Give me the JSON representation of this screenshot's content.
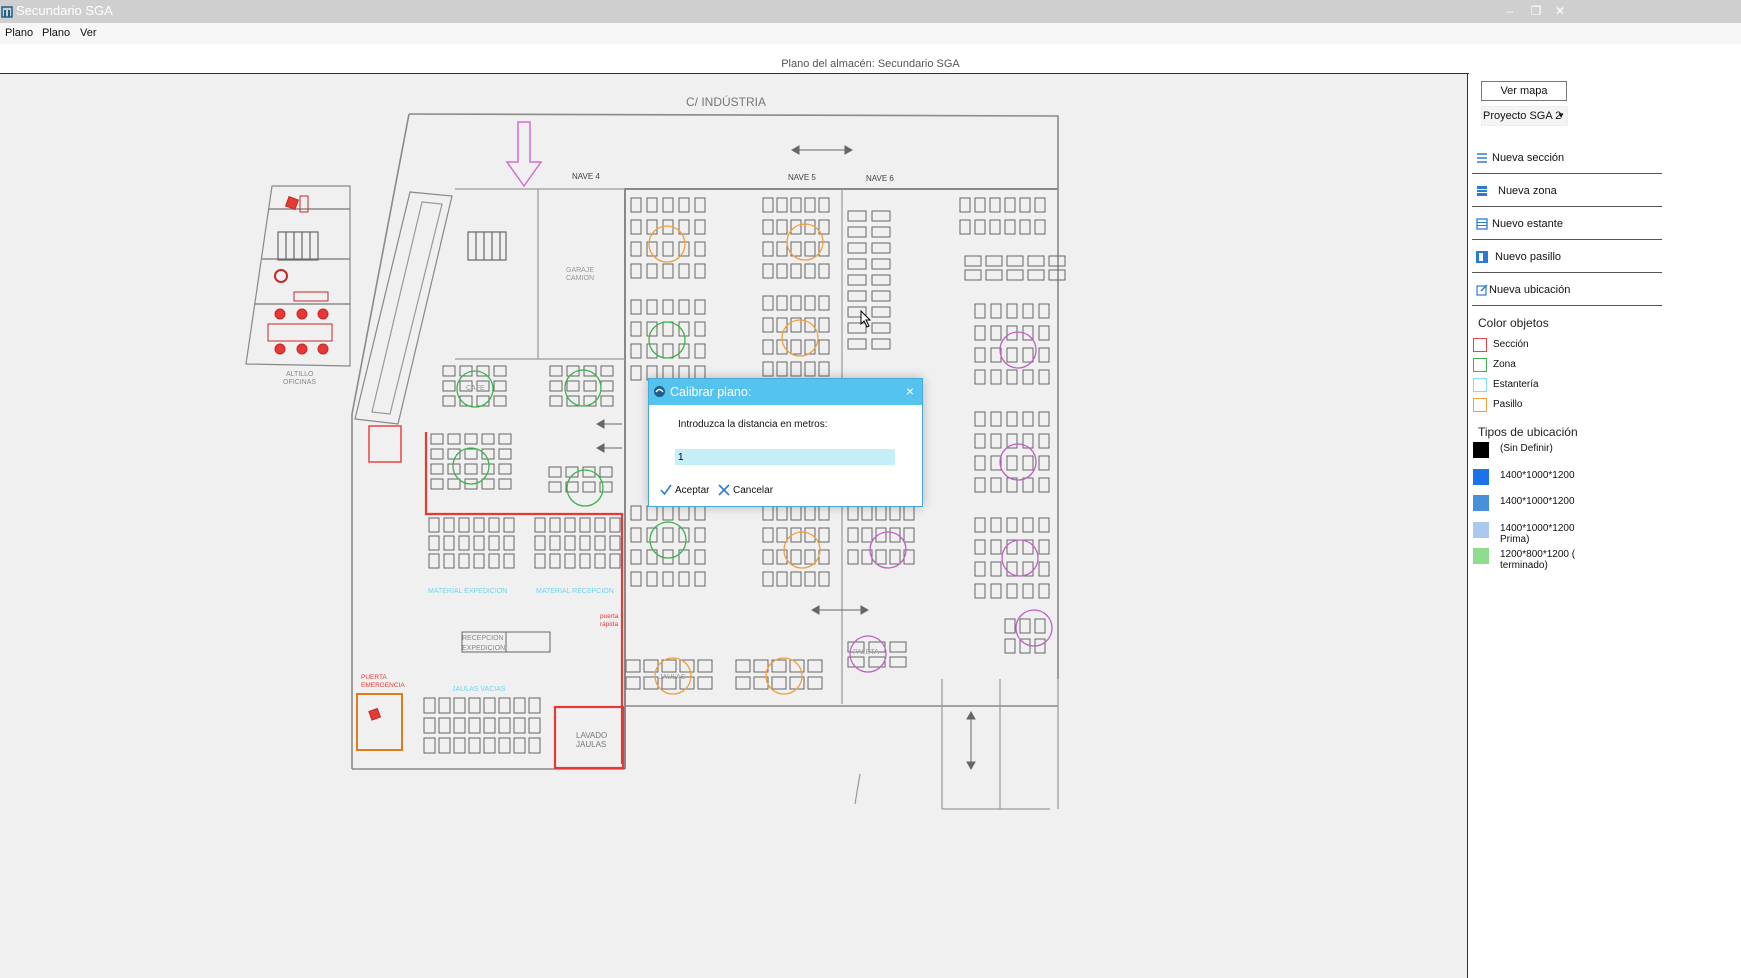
{
  "window": {
    "title": "Secundario SGA",
    "controls": [
      "minimize",
      "maximize",
      "close"
    ]
  },
  "menu": [
    "Plano",
    "Plano",
    "Ver"
  ],
  "plan_title": "Plano del almacén: Secundario SGA",
  "floorplan": {
    "street_label": "C/ INDÚSTRIA",
    "nave_labels": [
      "NAVE 4",
      "NAVE 5",
      "NAVE 6"
    ],
    "office_label_1": "ALTILLO",
    "office_label_2": "OFICINAS",
    "garage_label_1": "GARAJE",
    "garage_label_2": "CAMION",
    "material_expedicion": "MATERIAL EXPEDICION",
    "material_recepcion": "MATERIAL RECEPCION",
    "recepcion_label_1": "RECEPCION",
    "recepcion_label_2": "EXPEDICION",
    "lavado_label_1": "LAVADO",
    "lavado_label_2": "JAULAS",
    "jaulas_vacias": "JAULAS VACIAS",
    "puerta_emergencia_1": "PUERTA",
    "puerta_emergencia_2": "EMERGENCIA",
    "puerta_rapida_1": "puerta",
    "puerta_rapida_2": "rápida",
    "cafe_label": "CAFE",
    "jaulas_label": "JAULAS",
    "paleta_label": "PALETA"
  },
  "sidebar": {
    "ver_mapa": "Ver mapa",
    "project": "Proyecto SGA 2",
    "actions": [
      {
        "label": "Nueva sección",
        "icon": "section-icon"
      },
      {
        "label": "Nueva zona",
        "icon": "zone-icon"
      },
      {
        "label": "Nuevo estante",
        "icon": "shelf-icon"
      },
      {
        "label": "Nuevo pasillo",
        "icon": "aisle-icon"
      },
      {
        "label": "Nueva ubicación",
        "icon": "location-icon"
      }
    ],
    "color_heading": "Color objetos",
    "colors": [
      {
        "label": "Sección",
        "color": "#e64545"
      },
      {
        "label": "Zona",
        "color": "#3cb34a"
      },
      {
        "label": "Estantería",
        "color": "#7fdff2"
      },
      {
        "label": "Pasillo",
        "color": "#f0a040"
      }
    ],
    "types_heading": "Tipos de ubicación",
    "types": [
      {
        "label": "(Sin Definir)",
        "label2": "",
        "color": "#000000"
      },
      {
        "label": "1400*1000*1200",
        "label2": "",
        "color": "#1a73e8"
      },
      {
        "label": "1400*1000*1200",
        "label2": "",
        "color": "#4a90d9"
      },
      {
        "label": "1400*1000*1200",
        "label2": "Prima)",
        "color": "#a9c8ee"
      },
      {
        "label": "1200*800*1200 (",
        "label2": "terminado)",
        "color": "#8fdc8f"
      }
    ]
  },
  "dialog": {
    "title": "Calibrar plano:",
    "prompt": "Introduzca la distancia en metros:",
    "value": "1",
    "accept": "Aceptar",
    "cancel": "Cancelar"
  }
}
